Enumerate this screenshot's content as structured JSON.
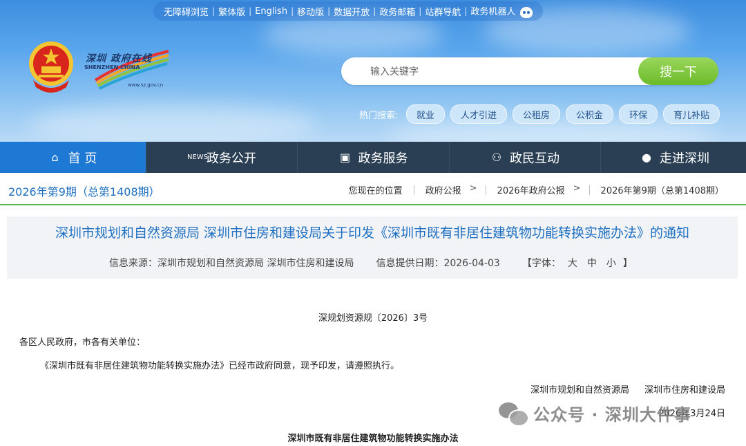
{
  "header": {
    "top_links": [
      "无障碍浏览",
      "繁体版",
      "English",
      "移动版",
      "数据开放",
      "政务邮箱",
      "站群导航",
      "政务机器人"
    ],
    "logo": {
      "name_cn": "深圳 政府在线",
      "name_en": "SHENZHEN CHINA",
      "url": "www.sz.gov.cn"
    },
    "search": {
      "placeholder": "输入关键字",
      "button": "搜一下"
    },
    "hot_search": {
      "label": "热门搜索:",
      "tags": [
        "就业",
        "人才引进",
        "公租房",
        "公积金",
        "环保",
        "育儿补贴"
      ]
    }
  },
  "nav": {
    "items": [
      {
        "label": "首 页",
        "icon": "home-icon"
      },
      {
        "label": "政务公开",
        "icon": "news-icon"
      },
      {
        "label": "政务服务",
        "icon": "monitor-icon"
      },
      {
        "label": "政民互动",
        "icon": "people-icon"
      },
      {
        "label": "走进深圳",
        "icon": "compass-icon"
      }
    ]
  },
  "issue": "2026年第9期（总第1408期）",
  "breadcrumb": [
    "您现在的位置",
    "政府公报",
    "2026年政府公报",
    "2026年第9期（总第1408期）"
  ],
  "article": {
    "title": "深圳市规划和自然资源局 深圳市住房和建设局关于印发《深圳市既有非居住建筑物功能转换实施办法》的通知",
    "source": "信息来源：深圳市规划和自然资源局 深圳市住房和建设局",
    "date": "信息提供日期：2026-04-03",
    "font_label": "【字体：",
    "font_sizes": [
      "大",
      "中",
      "小"
    ],
    "font_close": "】"
  },
  "body": {
    "doc_number": "深规划资源规〔2026〕3号",
    "salutation": "各区人民政府，市各有关单位：",
    "paragraph": "《深圳市既有非居住建筑物功能转换实施办法》已经市政府同意，现予印发，请遵照执行。",
    "signers": [
      "深圳市规划和自然资源局",
      "深圳市住房和建设局"
    ],
    "sign_date": "2026年3月24日",
    "watermark": "公众号 · 深圳大件事",
    "heading": "深圳市既有非居住建筑物功能转换实施办法"
  },
  "colors": {
    "nav_bg": "#2a3f54",
    "nav_active": "#1d79d4",
    "link_blue": "#1d6fc2",
    "search_green": "#7cc43f"
  }
}
